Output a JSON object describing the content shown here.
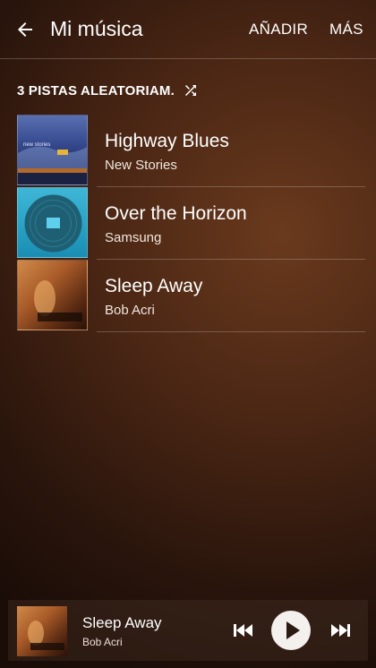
{
  "header": {
    "title": "Mi música",
    "add_label": "AÑADIR",
    "more_label": "MÁS"
  },
  "shuffle": {
    "label": "3 PISTAS ALEATORIAM."
  },
  "tracks": [
    {
      "title": "Highway Blues",
      "artist": "New Stories",
      "cover_text": "new stories"
    },
    {
      "title": "Over the Horizon",
      "artist": "Samsung"
    },
    {
      "title": "Sleep Away",
      "artist": "Bob Acri"
    }
  ],
  "player": {
    "title": "Sleep Away",
    "artist": "Bob Acri"
  },
  "colors": {
    "background": "#3d2012",
    "text": "#ffffff",
    "divider": "rgba(255,255,255,0.22)"
  }
}
